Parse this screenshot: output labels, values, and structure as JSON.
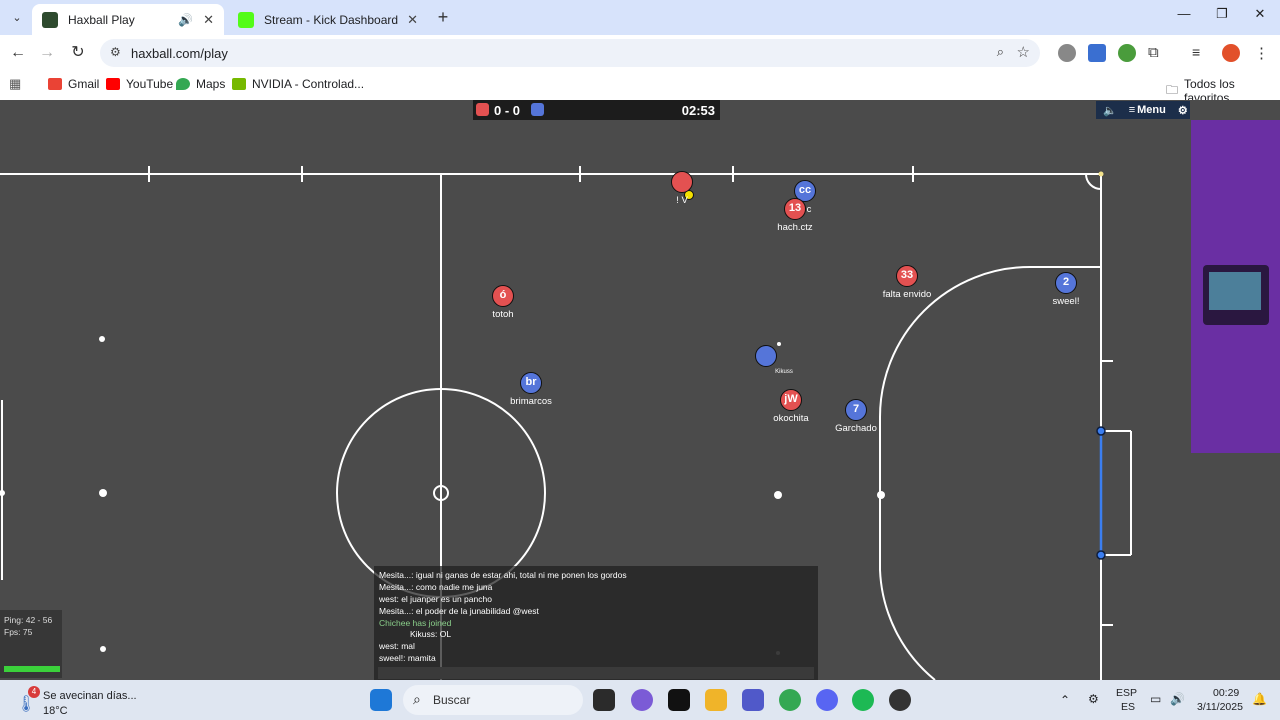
{
  "browser": {
    "tabs": [
      {
        "title": "Haxball Play",
        "active": true,
        "audio": true
      },
      {
        "title": "Stream - Kick Dashboard",
        "active": false,
        "audio": false
      }
    ],
    "url": "haxball.com/play",
    "bookmarks": [
      {
        "label": "Gmail",
        "color": "#ea4335"
      },
      {
        "label": "YouTube",
        "color": "#ff0000"
      },
      {
        "label": "Maps",
        "color": "#34a853"
      },
      {
        "label": "NVIDIA - Controlad...",
        "color": "#76b900"
      }
    ],
    "all_bookmarks_label": "Todos los favoritos"
  },
  "game": {
    "score": "0 - 0",
    "timer": "02:53",
    "menu_label": "Menu",
    "colors": {
      "red": "#e35151",
      "blue": "#5575d9",
      "pitch": "#4b4b4b",
      "lines": "#ffffff",
      "goal": "#3b7ef0"
    },
    "players": [
      {
        "avatar": "",
        "name": "! V",
        "team": "red"
      },
      {
        "avatar": "cc",
        "name": "c",
        "team": "blue"
      },
      {
        "avatar": "13",
        "name": "hach.ctz",
        "team": "red"
      },
      {
        "avatar": "33",
        "name": "falta envido",
        "team": "red"
      },
      {
        "avatar": "2",
        "name": "sweel!",
        "team": "blue"
      },
      {
        "avatar": "ó",
        "name": "totoh",
        "team": "red"
      },
      {
        "avatar": "br",
        "name": "brimarcos",
        "team": "blue"
      },
      {
        "avatar": "",
        "name": "Kikuss",
        "team": "blue"
      },
      {
        "avatar": "jW",
        "name": "okochita",
        "team": "red"
      },
      {
        "avatar": "7",
        "name": "Garchado",
        "team": "blue"
      }
    ],
    "chat": [
      {
        "text": "Mesita...: igual ni ganas de estar ahi, total ni me ponen los gordos",
        "type": "msg"
      },
      {
        "text": "Mesita...: como nadie me juna",
        "type": "msg"
      },
      {
        "text": "west: el juanper es un pancho",
        "type": "msg"
      },
      {
        "text": "Mesita...: el poder de la junabilidad @west",
        "type": "msg"
      },
      {
        "text": "Chichee has joined",
        "type": "join"
      },
      {
        "text": "Kikuss: OL",
        "type": "msg"
      },
      {
        "text": "west: mal",
        "type": "msg"
      },
      {
        "text": "sweel!: mamita",
        "type": "msg"
      }
    ],
    "ping_text": "Ping: 42 - 56",
    "fps_text": "Fps: 75"
  },
  "taskbar": {
    "weather_badge": "4",
    "weather_title": "Se avecinan días...",
    "weather_temp": "18°C",
    "search_placeholder": "Buscar",
    "lang_top": "ESP",
    "lang_bottom": "ES",
    "time": "00:29",
    "date": "3/11/2025"
  }
}
